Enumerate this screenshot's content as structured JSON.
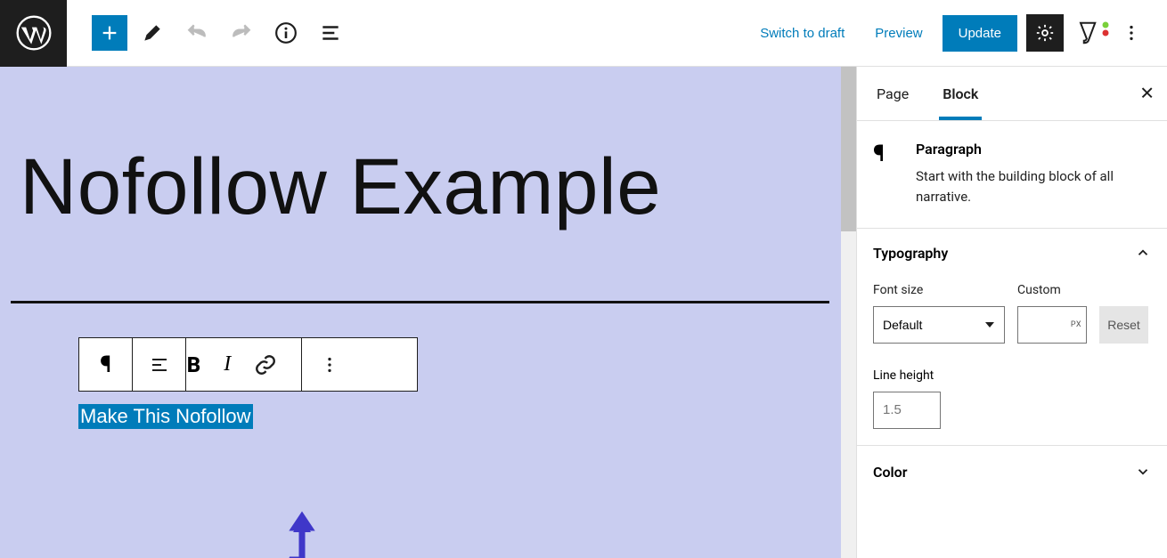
{
  "topbar": {
    "switch_to_draft": "Switch to draft",
    "preview": "Preview",
    "update": "Update"
  },
  "editor": {
    "page_title": "Nofollow Example",
    "selected_text": "Make This Nofollow"
  },
  "sidebar": {
    "tabs": {
      "page": "Page",
      "block": "Block"
    },
    "block_type": {
      "name": "Paragraph",
      "description": "Start with the building block of all narrative."
    },
    "typography": {
      "heading": "Typography",
      "font_size_label": "Font size",
      "font_size_value": "Default",
      "custom_label": "Custom",
      "custom_unit": "PX",
      "reset_label": "Reset",
      "line_height_label": "Line height",
      "line_height_placeholder": "1.5"
    },
    "color": {
      "heading": "Color"
    }
  },
  "icons": {
    "pilcrow": "¶",
    "close": "✕"
  }
}
